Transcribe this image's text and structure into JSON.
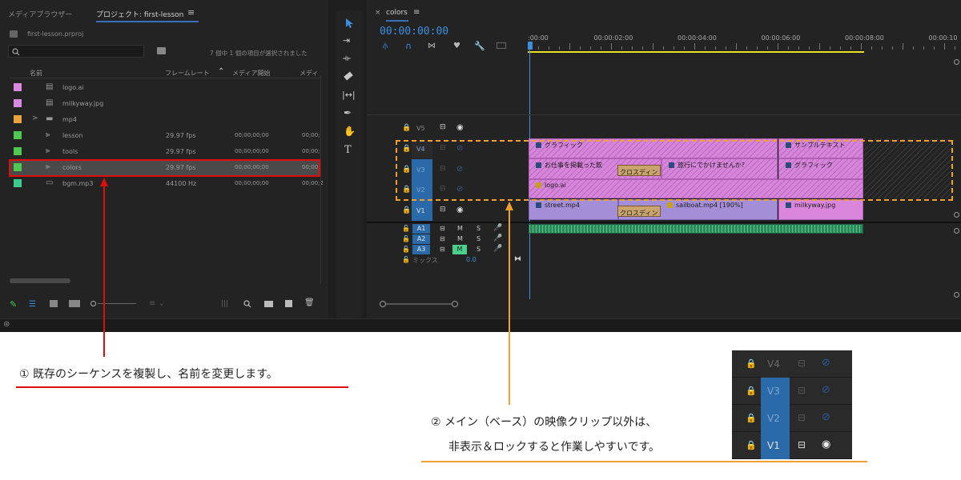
{
  "project": {
    "tabs": [
      "メディアブラウザー",
      "プロジェクト: first-lesson"
    ],
    "menu_icon": "≡",
    "file_name": "first-lesson.prproj",
    "search_icon": "search-icon",
    "selection_status": "7 個中 1 個の項目が選択されました",
    "columns": [
      "名前",
      "フレームレート",
      "メディア開始",
      "メディ"
    ],
    "items": [
      {
        "color": "#d98ae0",
        "icon": "image-file-icon",
        "name": "logo.ai",
        "fps": "",
        "start": "",
        "end": "",
        "expand": ""
      },
      {
        "color": "#d98ae0",
        "icon": "image-file-icon",
        "name": "milkyway.jpg",
        "fps": "",
        "start": "",
        "end": "",
        "expand": ""
      },
      {
        "color": "#e8a43a",
        "icon": "folder-icon",
        "name": "mp4",
        "fps": "",
        "start": "",
        "end": "",
        "expand": ">"
      },
      {
        "color": "#4ec84e",
        "icon": "sequence-icon",
        "name": "lesson",
        "fps": "29.97 fps",
        "start": "00;00;00;00",
        "end": "00;00;",
        "expand": ""
      },
      {
        "color": "#4ec84e",
        "icon": "sequence-icon",
        "name": "tools",
        "fps": "29.97 fps",
        "start": "00;00;00;00",
        "end": "00;00;",
        "expand": ""
      },
      {
        "color": "#4ec84e",
        "icon": "sequence-icon",
        "name": "colors",
        "fps": "29.97 fps",
        "start": "00;00;00;00",
        "end": "00;00",
        "expand": ""
      },
      {
        "color": "#3acc8e",
        "icon": "audio-file-icon",
        "name": "bgm.mp3",
        "fps": "44100 Hz",
        "start": "00;00;00;00",
        "end": "00;00;2",
        "expand": ""
      }
    ]
  },
  "tools": [
    "selection-tool-icon",
    "track-select-tool-icon",
    "ripple-edit-tool-icon",
    "razor-tool-icon",
    "slip-tool-icon",
    "pen-tool-icon",
    "hand-tool-icon",
    "type-tool-icon"
  ],
  "timeline": {
    "close": "×",
    "sequence_name": "colors",
    "menu_icon": "≡",
    "timecode": "00:00:00:00",
    "ruler": [
      ":00:00",
      "00:00:02:00",
      "00:00:04:00",
      "00:00:06:00",
      "00:00:08:00",
      "00:00:10"
    ],
    "tracks": {
      "video": [
        "V5",
        "V4",
        "V3",
        "V2",
        "V1"
      ],
      "audio": [
        "A1",
        "A2",
        "A3"
      ],
      "mute": "M",
      "solo": "S",
      "mix_label": "ミックス",
      "mix_value": "0.0"
    },
    "clips": {
      "v4_a": "グラフィック",
      "v4_b": "サンプルテキスト",
      "v3_a": "お仕事を掲載った飲",
      "v3_b": "旅行にでかけませんか？",
      "v3_c": "グラフィック",
      "v3_trans": "クロスディン",
      "v2_a": "logo.ai",
      "v1_a": "street.mp4",
      "v1_trans": "クロスディン",
      "v1_b": "sailboat.mp4 [190%]",
      "v1_c": "milkyway.jpg"
    }
  },
  "inset": {
    "rows": [
      "V4",
      "V3",
      "V2",
      "V1"
    ]
  },
  "notes": {
    "n1": "① 既存のシーケンスを複製し、名前を変更します。",
    "n2_line1": "② メイン（ベース）の映像クリップ以外は、",
    "n2_line2": "非表示＆ロックすると作業しやすいです。"
  },
  "colors": {
    "red": "#e00d0d",
    "orange": "#f0a030",
    "blue_timecode": "#3b8fe0",
    "track_blue": "#2a6aa8"
  }
}
